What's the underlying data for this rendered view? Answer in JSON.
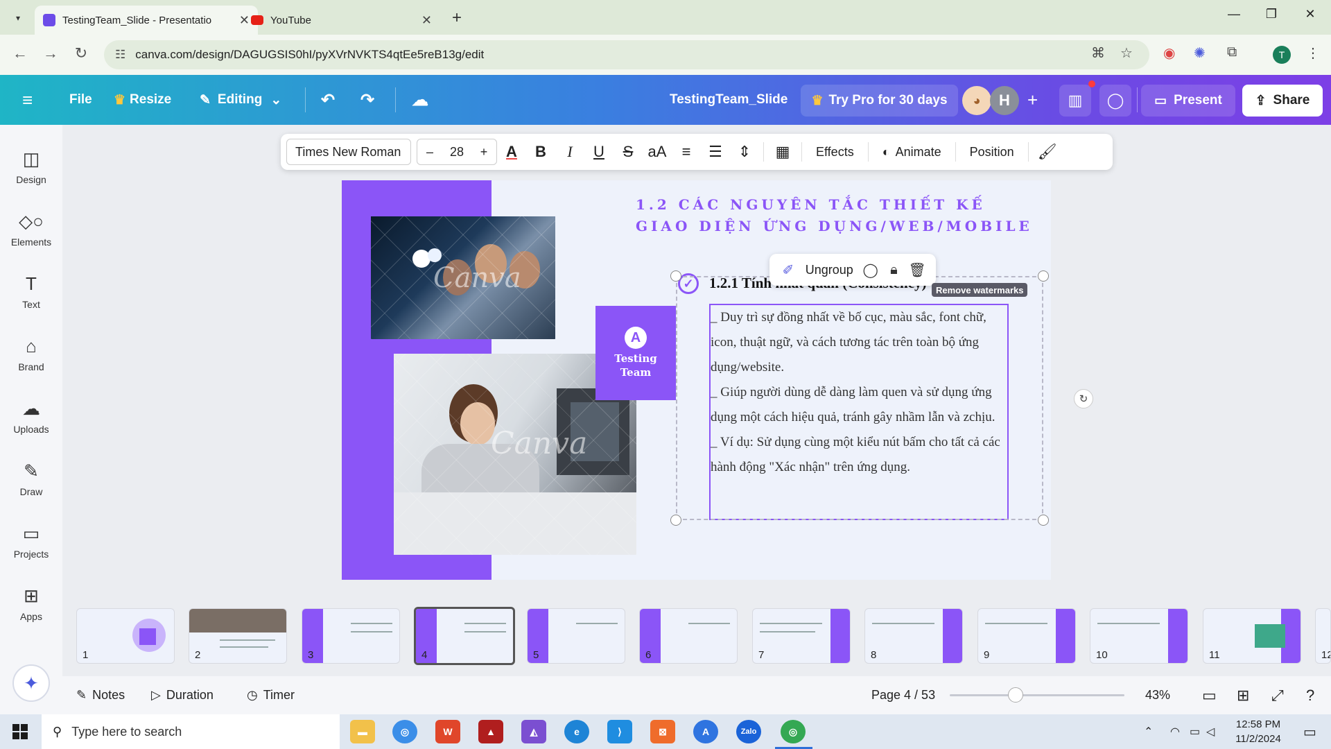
{
  "browser": {
    "tabs": [
      {
        "title": "TestingTeam_Slide - Presentatio",
        "active": true
      },
      {
        "title": "YouTube",
        "active": false
      }
    ],
    "url": "canva.com/design/DAGUGSIS0hI/pyXVrNVKTS4qtEe5reB13g/edit",
    "profile_initial": "T"
  },
  "canva_header": {
    "file": "File",
    "resize": "Resize",
    "editing": "Editing",
    "doc_title": "TestingTeam_Slide",
    "try_pro": "Try Pro for 30 days",
    "avatar_initial": "H",
    "present": "Present",
    "share": "Share"
  },
  "sidebar": {
    "items": [
      {
        "label": "Design",
        "icon": "design-icon"
      },
      {
        "label": "Elements",
        "icon": "elements-icon"
      },
      {
        "label": "Text",
        "icon": "text-icon"
      },
      {
        "label": "Brand",
        "icon": "brand-icon"
      },
      {
        "label": "Uploads",
        "icon": "uploads-icon"
      },
      {
        "label": "Draw",
        "icon": "draw-icon"
      },
      {
        "label": "Projects",
        "icon": "projects-icon"
      },
      {
        "label": "Apps",
        "icon": "apps-icon"
      }
    ]
  },
  "text_toolbar": {
    "font": "Times New Roman",
    "size": "28",
    "effects": "Effects",
    "animate": "Animate",
    "position": "Position"
  },
  "slide": {
    "title": "1.2 CÁC NGUYÊN TẮC THIẾT KẾ GIAO DIỆN ỨNG DỤNG/WEB/MOBILE",
    "logo_text_1": "Testing",
    "logo_text_2": "Team",
    "watermark": "Canva",
    "subheading": "1.2.1 Tính nhất quán (Consistency)",
    "body": [
      "_ Duy trì sự đồng nhất về bố cục, màu sắc, font chữ, icon, thuật ngữ, và cách tương tác trên toàn bộ ứng dụng/website.",
      "_ Giúp người dùng dễ dàng làm quen và sử dụng ứng dụng một cách hiệu quả, tránh gây nhầm lẫn và zchịu.",
      "_ Ví dụ: Sử dụng cùng một kiểu nút bấm cho tất cả các hành động \"Xác nhận\" trên ứng dụng."
    ]
  },
  "context_menu": {
    "ungroup": "Ungroup",
    "remove_watermarks": "Remove watermarks"
  },
  "thumbnails": [
    "1",
    "2",
    "3",
    "4",
    "5",
    "6",
    "7",
    "8",
    "9",
    "10",
    "11",
    "12"
  ],
  "bottom_bar": {
    "notes": "Notes",
    "duration": "Duration",
    "timer": "Timer",
    "page": "Page 4 / 53",
    "zoom": "43%",
    "zoom_level": 0.43
  },
  "taskbar": {
    "search_placeholder": "Type here to search",
    "time": "12:58 PM",
    "date": "11/2/2024"
  },
  "colors": {
    "accent": "#8b55f7",
    "header_start": "#1fb5c6",
    "header_end": "#7d3fe6"
  }
}
